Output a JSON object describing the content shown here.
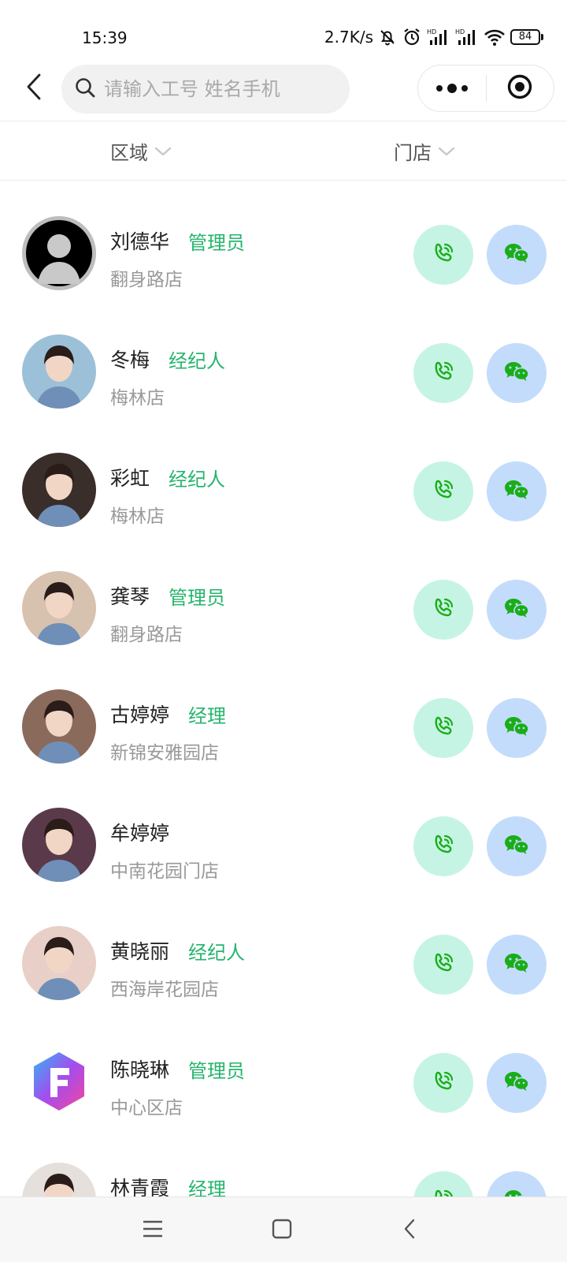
{
  "status_bar": {
    "time": "15:39",
    "net_speed": "2.7K/s",
    "battery": "84",
    "icons": [
      "mute-bell-icon",
      "alarm-icon",
      "hd-signal-icon",
      "hd-signal-icon",
      "wifi-icon",
      "battery-icon"
    ]
  },
  "header": {
    "back_icon": "back-arrow-icon",
    "search_icon": "search-icon",
    "search_placeholder": "请输入工号 姓名手机",
    "search_value": "",
    "more_icon": "more-dots-icon",
    "close_icon": "target-circle-icon"
  },
  "filters": {
    "region_label": "区域",
    "store_label": "门店",
    "arrow_icon": "chevron-down-icon"
  },
  "staff": [
    {
      "name": "刘德华",
      "role": "管理员",
      "store": "翻身路店",
      "avatar_color": "#bdbdbd"
    },
    {
      "name": "冬梅",
      "role": "经纪人",
      "store": "梅林店",
      "avatar_color": "#9cc0d8"
    },
    {
      "name": "彩虹",
      "role": "经纪人",
      "store": "梅林店",
      "avatar_color": "#3a2e2a"
    },
    {
      "name": "龚琴",
      "role": "管理员",
      "store": "翻身路店",
      "avatar_color": "#d7c2b0"
    },
    {
      "name": "古婷婷",
      "role": "经理",
      "store": "新锦安雅园店",
      "avatar_color": "#8a6a5a"
    },
    {
      "name": "牟婷婷",
      "role": "",
      "store": "中南花园门店",
      "avatar_color": "#5a3a4a"
    },
    {
      "name": "黄晓丽",
      "role": "经纪人",
      "store": "西海岸花园店",
      "avatar_color": "#e8d0c8"
    },
    {
      "name": "陈晓琳",
      "role": "管理员",
      "store": "中心区店",
      "avatar_color": "#ffffff"
    },
    {
      "name": "林青霞",
      "role": "经理",
      "store": "",
      "avatar_color": "#e6e0dc"
    }
  ],
  "actions": {
    "call_icon": "phone-call-icon",
    "wechat_icon": "wechat-icon"
  },
  "colors": {
    "role_green": "#25b56c",
    "call_bg": "#c6f4e4",
    "wechat_bg": "#c4dcfb",
    "icon_green": "#1aad19"
  },
  "nav_bar": {
    "menu_icon": "menu-icon",
    "home_icon": "home-square-icon",
    "back_icon": "nav-back-icon"
  }
}
